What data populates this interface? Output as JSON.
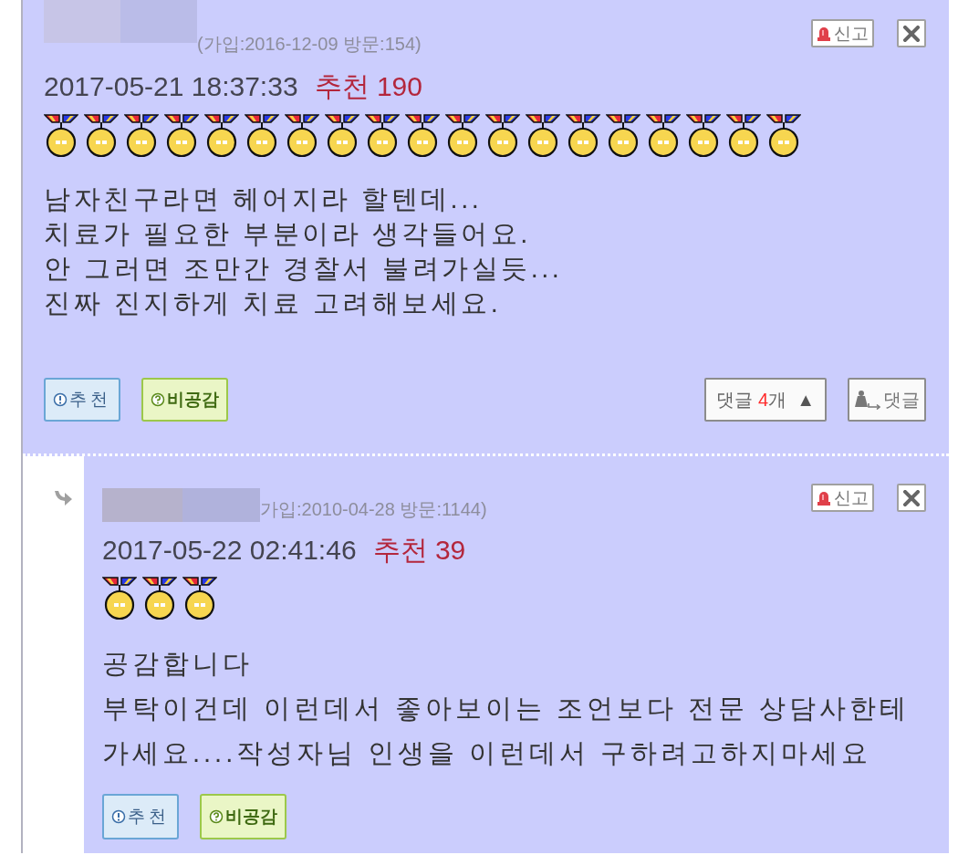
{
  "comments": [
    {
      "kind": "comment",
      "join_info": "(가입:2016-12-09 방문:154)",
      "report_button": "신고",
      "datetime": "2017-05-21 18:37:33",
      "recommend": "추천 190",
      "medals": [
        {
          "kind": "medal"
        },
        {
          "kind": "medal"
        },
        {
          "kind": "medal"
        },
        {
          "kind": "medal"
        },
        {
          "kind": "medal"
        },
        {
          "kind": "medal"
        },
        {
          "kind": "medal"
        },
        {
          "kind": "medal"
        },
        {
          "kind": "medal"
        },
        {
          "kind": "medal"
        },
        {
          "kind": "medal"
        },
        {
          "kind": "medal"
        },
        {
          "kind": "medal"
        },
        {
          "kind": "medal"
        },
        {
          "kind": "medal"
        },
        {
          "kind": "medal"
        },
        {
          "kind": "medal"
        },
        {
          "kind": "medal"
        },
        {
          "kind": "medal"
        }
      ],
      "body": [
        "남자친구라면 헤어지라 할텐데...",
        "치료가 필요한 부분이라 생각들어요.",
        "안 그러면 조만간 경찰서 불려가실듯...",
        "진짜 진지하게 치료 고려해보세요."
      ],
      "actions": [
        {
          "kind": "recommend",
          "label": "추천"
        },
        {
          "kind": "disagree",
          "label": "비공감"
        }
      ],
      "replies_toggle": {
        "label": "댓글",
        "count": "4",
        "unit": "개",
        "arrow": "▲"
      },
      "reply_button": "댓글"
    },
    {
      "kind": "reply",
      "join_info": "가입:2010-04-28 방문:1144)",
      "report_button": "신고",
      "datetime": "2017-05-22 02:41:46",
      "recommend": "추천 39",
      "medals": [
        {
          "kind": "medal"
        },
        {
          "kind": "medal"
        },
        {
          "kind": "medal"
        }
      ],
      "body": [
        "공감합니다",
        "부탁이건데 이런데서 좋아보이는 조언보다 전문 상담사한테",
        "가세요....작성자님 인생을 이런데서 구하려고하지마세요"
      ],
      "actions": [
        {
          "kind": "recommend",
          "label": "추천"
        },
        {
          "kind": "disagree",
          "label": "비공감"
        }
      ]
    }
  ]
}
